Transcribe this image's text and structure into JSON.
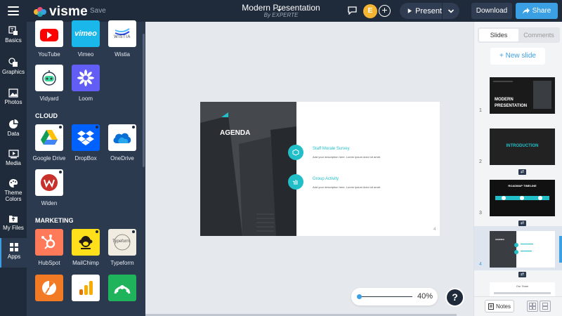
{
  "topbar": {
    "brand": "visme",
    "save_label": "Save",
    "presentation_title": "Modern Presentation",
    "presentation_author": "By EXPERTE",
    "avatar_initial": "E",
    "present_label": "Present",
    "download_label": "Download",
    "share_label": "Share"
  },
  "nav": [
    {
      "label": "Basics",
      "icon": "basics-icon"
    },
    {
      "label": "Graphics",
      "icon": "graphics-icon"
    },
    {
      "label": "Photos",
      "icon": "photos-icon"
    },
    {
      "label": "Data",
      "icon": "data-icon"
    },
    {
      "label": "Media",
      "icon": "media-icon"
    },
    {
      "label": "Theme Colors",
      "icon": "palette-icon"
    },
    {
      "label": "My Files",
      "icon": "folder-icon"
    },
    {
      "label": "Apps",
      "icon": "apps-icon"
    }
  ],
  "apps": {
    "top": [
      {
        "label": "YouTube"
      },
      {
        "label": "Vimeo"
      },
      {
        "label": "Wistia"
      },
      {
        "label": "Vidyard"
      },
      {
        "label": "Loom"
      }
    ],
    "cloud_heading": "CLOUD",
    "cloud": [
      {
        "label": "Google Drive"
      },
      {
        "label": "DropBox"
      },
      {
        "label": "OneDrive"
      },
      {
        "label": "Widen"
      }
    ],
    "marketing_heading": "MARKETING",
    "marketing": [
      {
        "label": "HubSpot"
      },
      {
        "label": "MailChimp"
      },
      {
        "label": "Typeform"
      }
    ],
    "tile_texts": {
      "vimeo": "vimeo",
      "wistia": "WISTIA",
      "typeform": "Typeform"
    }
  },
  "slide": {
    "heading": "AGENDA",
    "items": [
      {
        "title": "Staff Morale Survey",
        "desc": "Add your description here. Lorem ipsum dolor sit amet."
      },
      {
        "title": "Group Activity",
        "desc": "Add your description here. Lorem ipsum dolor sit amet."
      }
    ],
    "page_number": "4"
  },
  "zoom": {
    "value": "40%",
    "level": 0.4
  },
  "help_label": "?",
  "right_panel": {
    "tab_slides": "Slides",
    "tab_comments": "Comments",
    "new_slide": "+ New slide",
    "thumbs": [
      {
        "num": "1",
        "title": "MODERN PRESENTATION"
      },
      {
        "num": "2",
        "title": "INTRODUCTION"
      },
      {
        "num": "3",
        "title": "ROADMAP TIMELINE"
      },
      {
        "num": "4",
        "title": "AGENDA"
      },
      {
        "title": "Our Team"
      }
    ],
    "notes_label": "Notes"
  },
  "colors": {
    "accent": "#3a9fe3",
    "teal": "#22bfc8",
    "dark": "#1f2a3a",
    "panel": "#2c3a4f"
  }
}
